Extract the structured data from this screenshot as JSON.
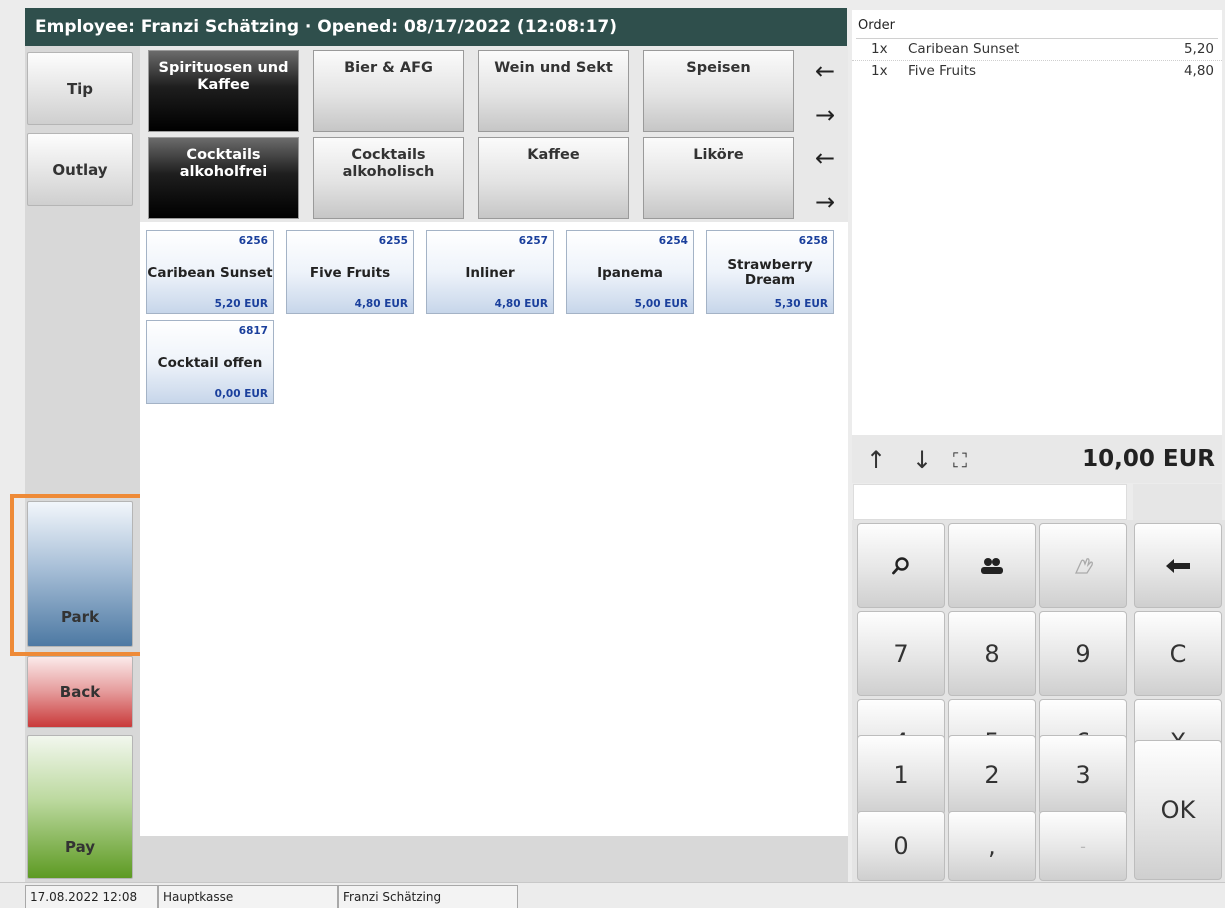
{
  "header": {
    "title": "Employee: Franzi Schätzing · Opened: 08/17/2022 (12:08:17)"
  },
  "left_buttons": {
    "tip": "Tip",
    "outlay": "Outlay",
    "park": "Park",
    "back": "Back",
    "pay": "Pay"
  },
  "categories_row1": [
    {
      "label": "Spirituosen und Kaffee",
      "active": true
    },
    {
      "label": "Bier & AFG",
      "active": false
    },
    {
      "label": "Wein und Sekt",
      "active": false
    },
    {
      "label": "Speisen",
      "active": false
    }
  ],
  "categories_row2": [
    {
      "label": "Cocktails alkoholfrei",
      "active": true
    },
    {
      "label": "Cocktails alkoholisch",
      "active": false
    },
    {
      "label": "Kaffee",
      "active": false
    },
    {
      "label": "Liköre",
      "active": false
    }
  ],
  "arrows": {
    "left": "←",
    "right": "→"
  },
  "products": [
    {
      "number": "6256",
      "name": "Caribean Sunset",
      "price": "5,20 EUR"
    },
    {
      "number": "6255",
      "name": "Five Fruits",
      "price": "4,80 EUR"
    },
    {
      "number": "6257",
      "name": "Inliner",
      "price": "4,80 EUR"
    },
    {
      "number": "6254",
      "name": "Ipanema",
      "price": "5,00 EUR"
    },
    {
      "number": "6258",
      "name": "Strawberry Dream",
      "price": "5,30 EUR"
    },
    {
      "number": "6817",
      "name": "Cocktail offen",
      "price": "0,00 EUR"
    }
  ],
  "order": {
    "title": "Order",
    "lines": [
      {
        "qty": "1x",
        "name": "Caribean Sunset",
        "price": "5,20"
      },
      {
        "qty": "1x",
        "name": "Five Fruits",
        "price": "4,80"
      }
    ],
    "total": "10,00 EUR"
  },
  "nav_icons": {
    "up": "↑",
    "down": "↓",
    "expand": "⛶"
  },
  "keypad": {
    "row1": [
      "search-icon",
      "customers-icon",
      "hand-icon",
      "backspace-icon"
    ],
    "digits": [
      "7",
      "8",
      "9",
      "C",
      "4",
      "5",
      "6",
      "X",
      "1",
      "2",
      "3",
      "0",
      ",",
      "-"
    ],
    "ok": "OK"
  },
  "statusbar": {
    "datetime": "17.08.2022 12:08",
    "register": "Hauptkasse",
    "employee": "Franzi Schätzing"
  }
}
